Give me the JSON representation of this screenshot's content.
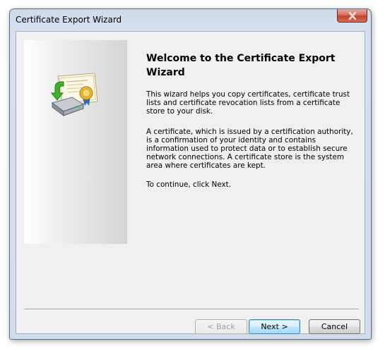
{
  "window": {
    "title": "Certificate Export Wizard",
    "close_glyph": "✕"
  },
  "banner": {
    "icon": "certificate-export-icon"
  },
  "content": {
    "heading": "Welcome to the Certificate Export Wizard",
    "paragraph1": "This wizard helps you copy certificates, certificate trust lists and certificate revocation lists from a certificate store to your disk.",
    "paragraph2": "A certificate, which is issued by a certification authority, is a confirmation of your identity and contains information used to protect data or to establish secure network connections. A certificate store is the system area where certificates are kept.",
    "paragraph3": "To continue, click Next."
  },
  "buttons": {
    "back": "< Back",
    "next": "Next >",
    "cancel": "Cancel"
  },
  "colors": {
    "title_bar": "#d8e2ee",
    "close_button": "#c2432e",
    "default_button_border": "#3c7fb1"
  }
}
